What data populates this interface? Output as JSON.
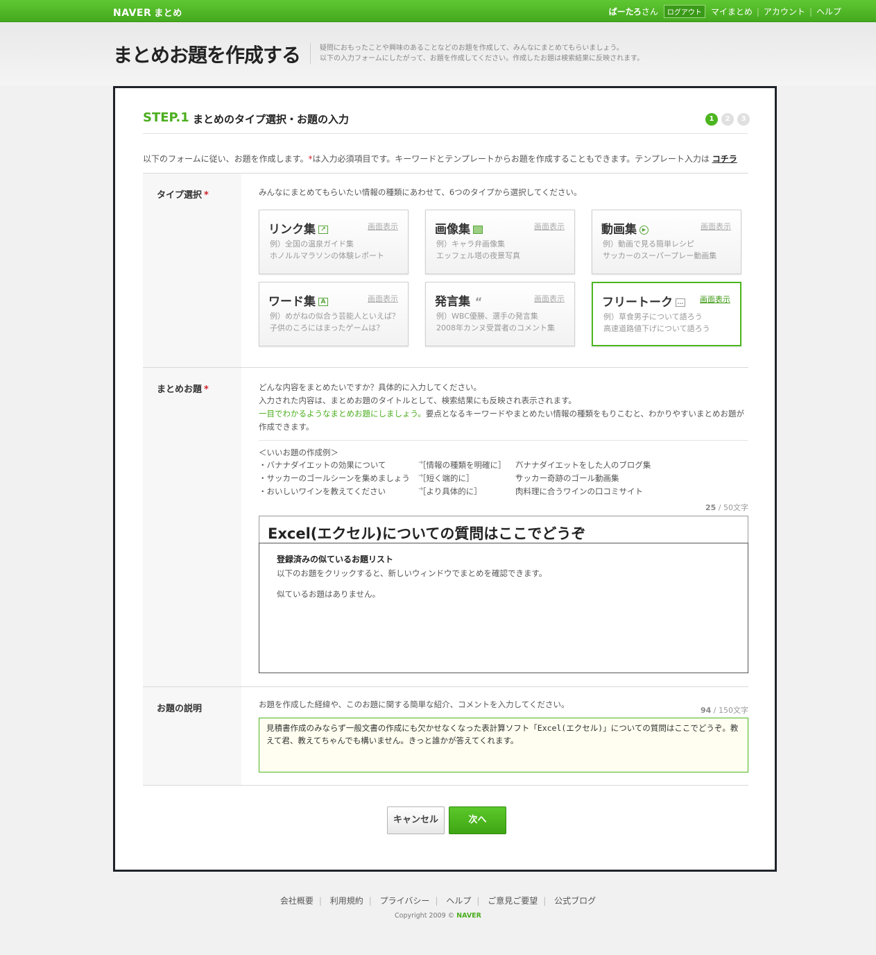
{
  "topbar": {
    "logo": "NAVER",
    "logo_suffix": "まとめ",
    "username": "ぱーたろ",
    "honorific": "さん",
    "logout": "ログアウト",
    "links": [
      "マイまとめ",
      "アカウント",
      "ヘルプ"
    ]
  },
  "header": {
    "title": "まとめお題を作成する",
    "desc_line1": "疑問におもったことや興味のあることなどのお題を作成して、みんなにまとめてもらいましょう。",
    "desc_line2": "以下の入力フォームにしたがって、お題を作成してください。作成したお題は検索結果に反映されます。"
  },
  "step": {
    "label": "STEP.1",
    "title": "まとめのタイプ選択・お題の入力",
    "indicators": [
      "1",
      "2",
      "3"
    ],
    "active": 1
  },
  "intro": {
    "text1": "以下のフォームに従い、お題を作成します。",
    "req": "*",
    "text2": "は入力必須項目です。キーワードとテンプレートからお題を作成することもできます。テンプレート入力は",
    "link": "コチラ"
  },
  "type_section": {
    "label": "タイプ選択",
    "req": "*",
    "note": "みんなにまとめてもらいたい情報の種類にあわせて、6つのタイプから選択してください。",
    "preview_label": "画面表示",
    "cards": [
      {
        "name": "リンク集",
        "icon": "link-icon",
        "ex1": "例）全国の温泉ガイド集",
        "ex2": "ホノルルマラソンの体験レポート"
      },
      {
        "name": "画像集",
        "icon": "image-icon",
        "ex1": "例）キャラ弁画像集",
        "ex2": "エッフェル塔の夜景写真"
      },
      {
        "name": "動画集",
        "icon": "play-icon",
        "ex1": "例）動画で見る簡単レシピ",
        "ex2": "サッカーのスーパープレー動画集"
      },
      {
        "name": "ワード集",
        "icon": "word-icon",
        "ex1": "例）めがねの似合う芸能人といえば？",
        "ex2": "子供のころにはまったゲームは？"
      },
      {
        "name": "発言集",
        "icon": "quote-icon",
        "ex1": "例）WBC優勝、選手の発言集",
        "ex2": "2008年カンヌ受賞者のコメント集"
      },
      {
        "name": "フリートーク",
        "icon": "speech-bubble-icon",
        "ex1": "例）草食男子について語ろう",
        "ex2": "高速道路値下げについて語ろう"
      }
    ],
    "selected_index": 5
  },
  "title_section": {
    "label": "まとめお題",
    "req": "*",
    "note1": "どんな内容をまとめたいですか？具体的に入力してください。",
    "note2": "入力された内容は、まとめお題のタイトルとして、検索結果にも反映され表示されます。",
    "note3_green": "一目でわかるようなまとめお題にしましょう。",
    "note3_rest": "要点となるキーワードやまとめたい情報の種類をもりこむと、わかりやすいまとめお題が",
    "note4": "作成できます。",
    "examples_head": "＜いいお題の作成例＞",
    "examples": [
      {
        "before": "・バナナダイエットの効果について",
        "hint": "［情報の種類を明確に］",
        "after": "バナナダイエットをした人のブログ集"
      },
      {
        "before": "・サッカーのゴールシーンを集めましょう",
        "hint": "［短く端的に］",
        "after": "サッカー奇跡のゴール動画集"
      },
      {
        "before": "・おいしいワインを教えてください",
        "hint": "［より具体的に］",
        "after": "肉料理に合うワインの口コミサイト"
      }
    ],
    "count": "25",
    "limit": "/ 50文字",
    "value": "Excel(エクセル)についての質問はここでどうぞ",
    "similar_title": "登録済みの似ているお題リスト",
    "similar_sub": "以下のお題をクリックすると、新しいウィンドウでまとめを確認できます。",
    "similar_none": "似ているお題はありません。"
  },
  "desc_section": {
    "label": "お題の説明",
    "note": "お題を作成した経緯や、このお題に関する簡単な紹介、コメントを入力してください。",
    "count": "94",
    "limit": "/ 150文字",
    "value": "見積書作成のみならず一般文書の作成にも欠かせなくなった表計算ソフト「Excel(エクセル)」についての質問はここでどうぞ。教えて君、教えてちゃんでも構いません。きっと誰かが答えてくれます。"
  },
  "buttons": {
    "cancel": "キャンセル",
    "next": "次へ"
  },
  "footer": {
    "links": [
      "会社概要",
      "利用規約",
      "プライバシー",
      "ヘルプ",
      "ご意見ご要望",
      "公式ブログ"
    ],
    "copyright": "Copyright 2009 ©",
    "brand": "NAVER"
  },
  "colors": {
    "accent_green": "#4cb51f",
    "required_red": "#d0222a",
    "panel_border": "#1f2329"
  }
}
